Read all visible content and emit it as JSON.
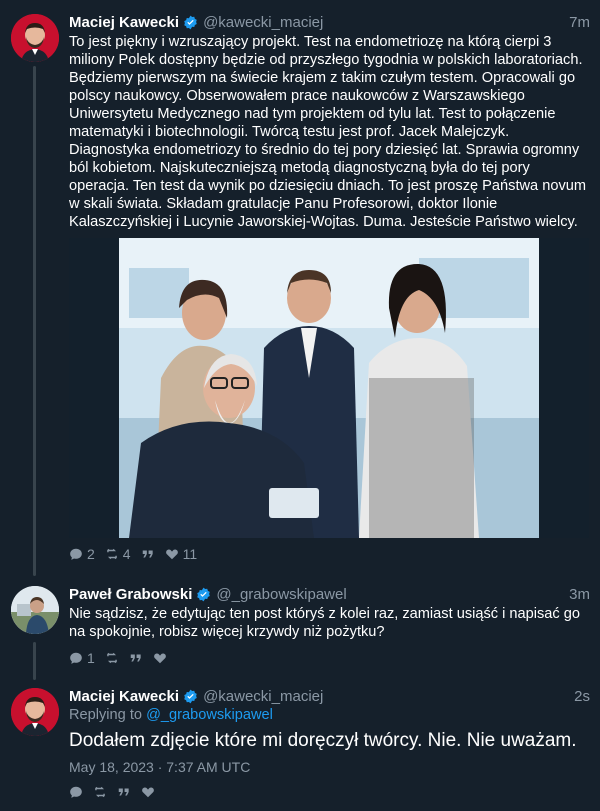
{
  "colors": {
    "background": "#15202b",
    "text": "#ffffff",
    "muted": "#8b98a5",
    "link": "#1d9bf0",
    "verified": "#1d9bf0"
  },
  "posts": [
    {
      "author": "Maciej Kawecki",
      "handle": "@kawecki_maciej",
      "time": "7m",
      "text": "To jest piękny i wzruszający projekt. Test na endometriozę na którą cierpi 3 miliony Polek dostępny będzie od przyszłego tygodnia w polskich laboratoriach. Będziemy pierwszym na świecie krajem z takim czułym testem. Opracowali go polscy naukowcy. Obserwowałem prace naukowców z Warszawskiego Uniwersytetu Medycznego nad tym projektem od tylu lat. Test to połączenie matematyki i biotechnologii. Twórcą testu jest prof. Jacek Malejczyk. Diagnostyka endometriozy to średnio do tej pory dziesięć lat. Sprawia ogromny ból kobietom. Najskuteczniejszą metodą diagnostyczną była do tej pory operacja. Ten test da wynik po dziesięciu dniach. To jest proszę Państwa novum w skali świata. Składam gratulacje Panu Profesorowi, doktor Ilonie Kalaszczyńskiej i Lucynie Jaworskiej-Wojtas. Duma. Jesteście Państwo wielcy.",
      "replies": "2",
      "retweets": "4",
      "likes": "11"
    },
    {
      "author": "Paweł Grabowski",
      "handle": "@_grabowskipawel",
      "time": "3m",
      "text": "Nie sądzisz, że edytując ten post któryś z kolei raz, zamiast usiąść i napisać go na spokojnie, robisz więcej krzywdy niż pożytku?",
      "replies": "1",
      "retweets": "",
      "likes": ""
    },
    {
      "author": "Maciej Kawecki",
      "handle": "@kawecki_maciej",
      "time": "2s",
      "replying_label": "Replying to",
      "replying_to": "@_grabowskipawel",
      "text": "Dodałem zdjęcie które mi doręczył twórcy. Nie. Nie uważam.",
      "timestamp": "May 18, 2023 · 7:37 AM UTC",
      "replies": "",
      "retweets": "",
      "likes": ""
    }
  ],
  "icons": {
    "reply": "reply-icon",
    "retweet": "retweet-icon",
    "quote": "quote-icon",
    "like": "heart-icon",
    "verified": "verified-badge-icon"
  }
}
